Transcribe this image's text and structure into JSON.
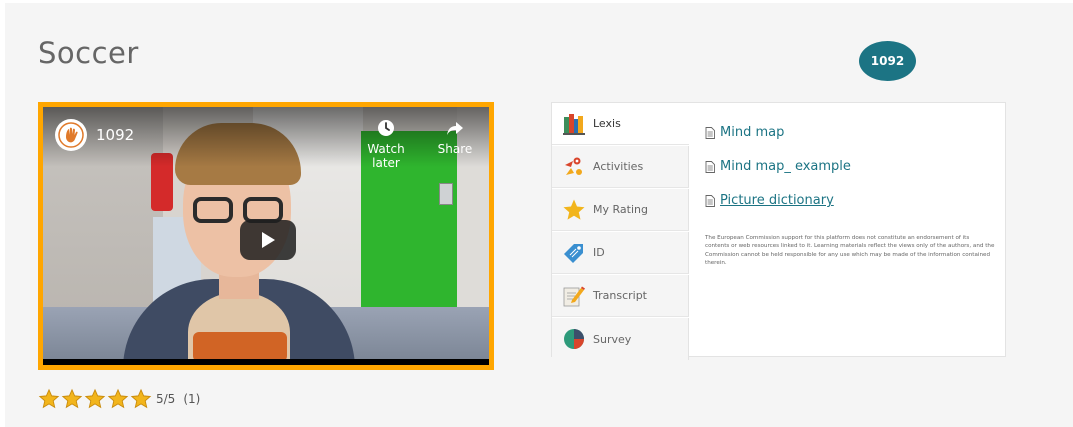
{
  "page": {
    "title": "Soccer",
    "views_badge": "1092"
  },
  "video": {
    "channel_title": "1092",
    "watch_later_label": "Watch later",
    "share_label": "Share",
    "border_color": "#ffa600"
  },
  "rating": {
    "stars_filled": 5,
    "stars_total": 5,
    "score_text": "5/5",
    "count_text": "(1)"
  },
  "tabs": [
    {
      "label": "Lexis",
      "icon": "books-icon",
      "active": true
    },
    {
      "label": "Activities",
      "icon": "activities-icon",
      "active": false
    },
    {
      "label": "My Rating",
      "icon": "star-icon",
      "active": false
    },
    {
      "label": "ID",
      "icon": "tag-icon",
      "active": false
    },
    {
      "label": "Transcript",
      "icon": "pencil-icon",
      "active": false
    },
    {
      "label": "Survey",
      "icon": "pie-chart-icon",
      "active": false
    }
  ],
  "lexis": {
    "links": [
      {
        "label": "Mind map",
        "underlined": false
      },
      {
        "label": "Mind map_ example",
        "underlined": false
      },
      {
        "label": "Picture dictionary",
        "underlined": true
      }
    ],
    "disclaimer": "The European Commission support for this platform does not constitute an endorsement of its contents or web resources linked to it. Learning materials reflect the views only of the authors, and the Commission cannot be held responsible for any use which may be made of the information contained therein."
  },
  "colors": {
    "accent": "#1c7484",
    "video_border": "#ffa600",
    "star": "#f2b51c"
  }
}
